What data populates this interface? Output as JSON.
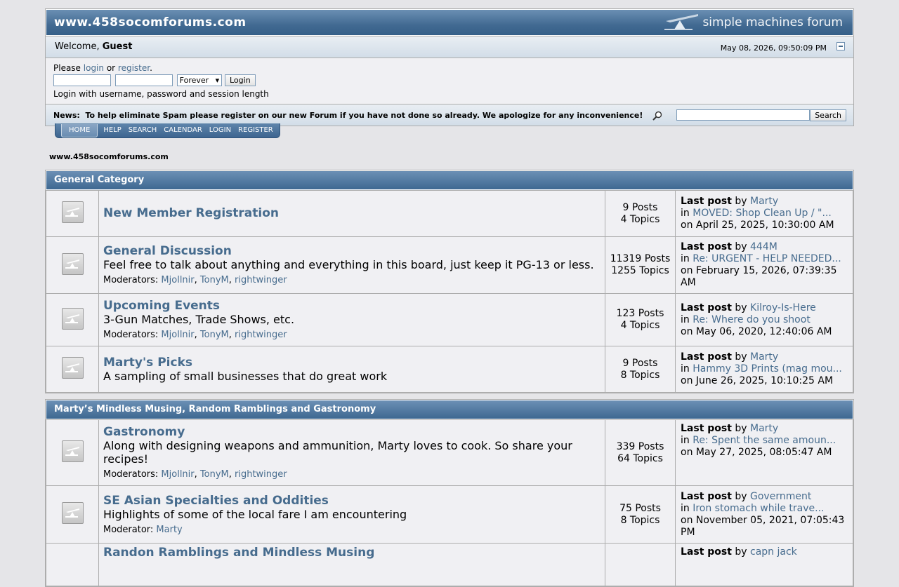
{
  "header": {
    "forum_name": "www.458socomforums.com",
    "logo_text": "simple machines forum",
    "welcome_prefix": "Welcome, ",
    "welcome_user": "Guest",
    "datetime": "May 08, 2026, 09:50:09 PM"
  },
  "login": {
    "please": "Please ",
    "login_link": "login",
    "or": " or ",
    "register_link": "register",
    "period": ".",
    "session_option": "Forever",
    "login_button": "Login",
    "help_text": "Login with username, password and session length"
  },
  "news": {
    "label": "News:",
    "text": "To help eliminate Spam please register on our new Forum if you have not done so already. We apologize for any inconvenience!",
    "search_button": "Search"
  },
  "menu": [
    "HOME",
    "HELP",
    "SEARCH",
    "CALENDAR",
    "LOGIN",
    "REGISTER"
  ],
  "breadcrumb": "www.458socomforums.com",
  "categories": [
    {
      "title": "General Category",
      "boards": [
        {
          "name": "New Member Registration",
          "desc": "",
          "mods_label": "",
          "mods": [],
          "posts": "9 Posts",
          "topics": "4 Topics",
          "last_label": "Last post",
          "by": " by ",
          "last_user": "Marty",
          "in": "in ",
          "last_topic": "MOVED: Shop Clean Up / \"...",
          "on": "on April 25, 2025, 10:30:00 AM"
        },
        {
          "name": "General Discussion",
          "desc": "Feel free to talk about anything and everything in this board, just keep it PG-13 or less.",
          "mods_label": "Moderators: ",
          "mods": [
            "Mjollnir",
            "TonyM",
            "rightwinger"
          ],
          "posts": "11319 Posts",
          "topics": "1255 Topics",
          "last_label": "Last post",
          "by": " by ",
          "last_user": "444M",
          "in": "in ",
          "last_topic": "Re: URGENT - HELP NEEDED...",
          "on": "on February 15, 2026, 07:39:35 AM"
        },
        {
          "name": "Upcoming Events",
          "desc": "3-Gun Matches, Trade Shows, etc.",
          "mods_label": "Moderators: ",
          "mods": [
            "Mjollnir",
            "TonyM",
            "rightwinger"
          ],
          "posts": "123 Posts",
          "topics": "4 Topics",
          "last_label": "Last post",
          "by": " by ",
          "last_user": "Kilroy-Is-Here",
          "in": "in ",
          "last_topic": "Re: Where do you shoot",
          "on": "on May 06, 2020, 12:40:06 AM"
        },
        {
          "name": "Marty's Picks",
          "desc": "A sampling of small businesses that do great work",
          "mods_label": "",
          "mods": [],
          "posts": "9 Posts",
          "topics": "8 Topics",
          "last_label": "Last post",
          "by": " by ",
          "last_user": "Marty",
          "in": "in ",
          "last_topic": "Hammy 3D Prints (mag mou...",
          "on": "on June 26, 2025, 10:10:25 AM"
        }
      ]
    },
    {
      "title": "Marty’s Mindless Musing, Random Ramblings and Gastronomy",
      "boards": [
        {
          "name": "Gastronomy",
          "desc": "Along with designing weapons and ammunition, Marty loves to cook. So share your recipes!",
          "mods_label": "Moderators: ",
          "mods": [
            "Mjollnir",
            "TonyM",
            "rightwinger"
          ],
          "posts": "339 Posts",
          "topics": "64 Topics",
          "last_label": "Last post",
          "by": " by ",
          "last_user": "Marty",
          "in": "in ",
          "last_topic": "Re: Spent the same amoun...",
          "on": "on May 27, 2025, 08:05:47 AM"
        },
        {
          "name": "SE Asian Specialties and Oddities",
          "desc": "Highlights of some of the local fare I am encountering",
          "mods_label": "Moderator: ",
          "mods": [
            "Marty"
          ],
          "posts": "75 Posts",
          "topics": "8 Topics",
          "last_label": "Last post",
          "by": " by ",
          "last_user": "Government",
          "in": "in ",
          "last_topic": "Iron stomach while trave...",
          "on": "on November 05, 2021, 07:05:43 PM"
        },
        {
          "name": "Randon Ramblings and Mindless Musing",
          "desc": "",
          "mods_label": "",
          "mods": [],
          "posts": "",
          "topics": "",
          "last_label": "Last post",
          "by": " by ",
          "last_user": "capn jack",
          "in": "",
          "last_topic": "",
          "on": ""
        }
      ]
    }
  ]
}
